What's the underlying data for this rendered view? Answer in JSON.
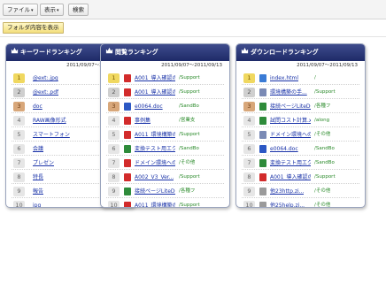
{
  "toolbar": {
    "file_label": "ファイル",
    "view_label": "表示",
    "search_label": "検索"
  },
  "folder_button_label": "フォルダ内容を表示",
  "panels": [
    {
      "title": "キーワードランキング",
      "date_range": "2011/09/07〜2011/09/13",
      "rows": [
        {
          "rank": "1",
          "text": "@ext:.jpg"
        },
        {
          "rank": "2",
          "text": "@ext:.pdf"
        },
        {
          "rank": "3",
          "text": "doc"
        },
        {
          "rank": "4",
          "text": "RAW画像形式"
        },
        {
          "rank": "5",
          "text": "スマートフォン"
        },
        {
          "rank": "6",
          "text": "会議"
        },
        {
          "rank": "7",
          "text": "プレゼン"
        },
        {
          "rank": "8",
          "text": "特長"
        },
        {
          "rank": "9",
          "text": "報告"
        },
        {
          "rank": "10",
          "text": "jpg"
        }
      ]
    },
    {
      "title": "閲覧ランキング",
      "date_range": "2011/09/07〜2011/09/13",
      "rows": [
        {
          "rank": "1",
          "text": "A001_導入確認の手...",
          "path": "/Support",
          "icon": "pdf",
          "icon_color": "#d22b2b"
        },
        {
          "rank": "2",
          "text": "A001_導入確認の手...",
          "path": "/Support",
          "icon": "pdf",
          "icon_color": "#d22b2b"
        },
        {
          "rank": "3",
          "text": "e0064.doc",
          "path": "/SandBo",
          "icon": "word",
          "icon_color": "#2c58c4"
        },
        {
          "rank": "4",
          "text": "事例集",
          "path": "/営業支",
          "icon": "pdf",
          "icon_color": "#d22b2b"
        },
        {
          "rank": "5",
          "text": "A011_環境構築の手...",
          "path": "/Support",
          "icon": "pdf",
          "icon_color": "#d22b2b"
        },
        {
          "rank": "6",
          "text": "変換テスト用エクセルフ...",
          "path": "/SandBo",
          "icon": "excel",
          "icon_color": "#2e8b3a"
        },
        {
          "rank": "7",
          "text": "ドメイン環境へのインス...",
          "path": "/その他",
          "icon": "pdf",
          "icon_color": "#d22b2b"
        },
        {
          "rank": "8",
          "text": "A002_V3_Ver...",
          "path": "/Support",
          "icon": "pdf",
          "icon_color": "#d22b2b"
        },
        {
          "rank": "9",
          "text": "接続ページLiteDO...",
          "path": "/各種フ",
          "icon": "excel",
          "icon_color": "#2e8b3a"
        },
        {
          "rank": "10",
          "text": "A011_環境構築の手...",
          "path": "/Support",
          "icon": "pdf",
          "icon_color": "#d22b2b"
        }
      ]
    },
    {
      "title": "ダウンロードランキング",
      "date_range": "2011/09/07〜2011/09/13",
      "rows": [
        {
          "rank": "1",
          "text": "index.html",
          "path": "/",
          "icon": "html",
          "icon_color": "#3a7bd5"
        },
        {
          "rank": "2",
          "text": "環境構築の手...",
          "path": "/Support",
          "icon": "generic",
          "icon_color": "#7a8ab5"
        },
        {
          "rank": "3",
          "text": "接続ページLiteDO...",
          "path": "/各種フ",
          "icon": "excel",
          "icon_color": "#2e8b3a"
        },
        {
          "rank": "4",
          "text": "試問コスト計算.xls",
          "path": "/along",
          "icon": "excel",
          "icon_color": "#2e8b3a"
        },
        {
          "rank": "5",
          "text": "ドメイン環境へのイ...",
          "path": "/その他",
          "icon": "generic",
          "icon_color": "#7a8ab5"
        },
        {
          "rank": "6",
          "text": "e0064.doc",
          "path": "/SandBo",
          "icon": "word",
          "icon_color": "#2c58c4"
        },
        {
          "rank": "7",
          "text": "変換テスト用エクセルフ...",
          "path": "/SandBo",
          "icon": "excel",
          "icon_color": "#2e8b3a"
        },
        {
          "rank": "8",
          "text": "A001_導入確認の手...",
          "path": "/Support",
          "icon": "pdf",
          "icon_color": "#d22b2b"
        },
        {
          "rank": "9",
          "text": "他23http.zi...",
          "path": "/その他",
          "icon": "zip",
          "icon_color": "#9a9a9a"
        },
        {
          "rank": "10",
          "text": "他25help.zi...",
          "path": "/その他",
          "icon": "zip",
          "icon_color": "#9a9a9a"
        }
      ]
    }
  ]
}
